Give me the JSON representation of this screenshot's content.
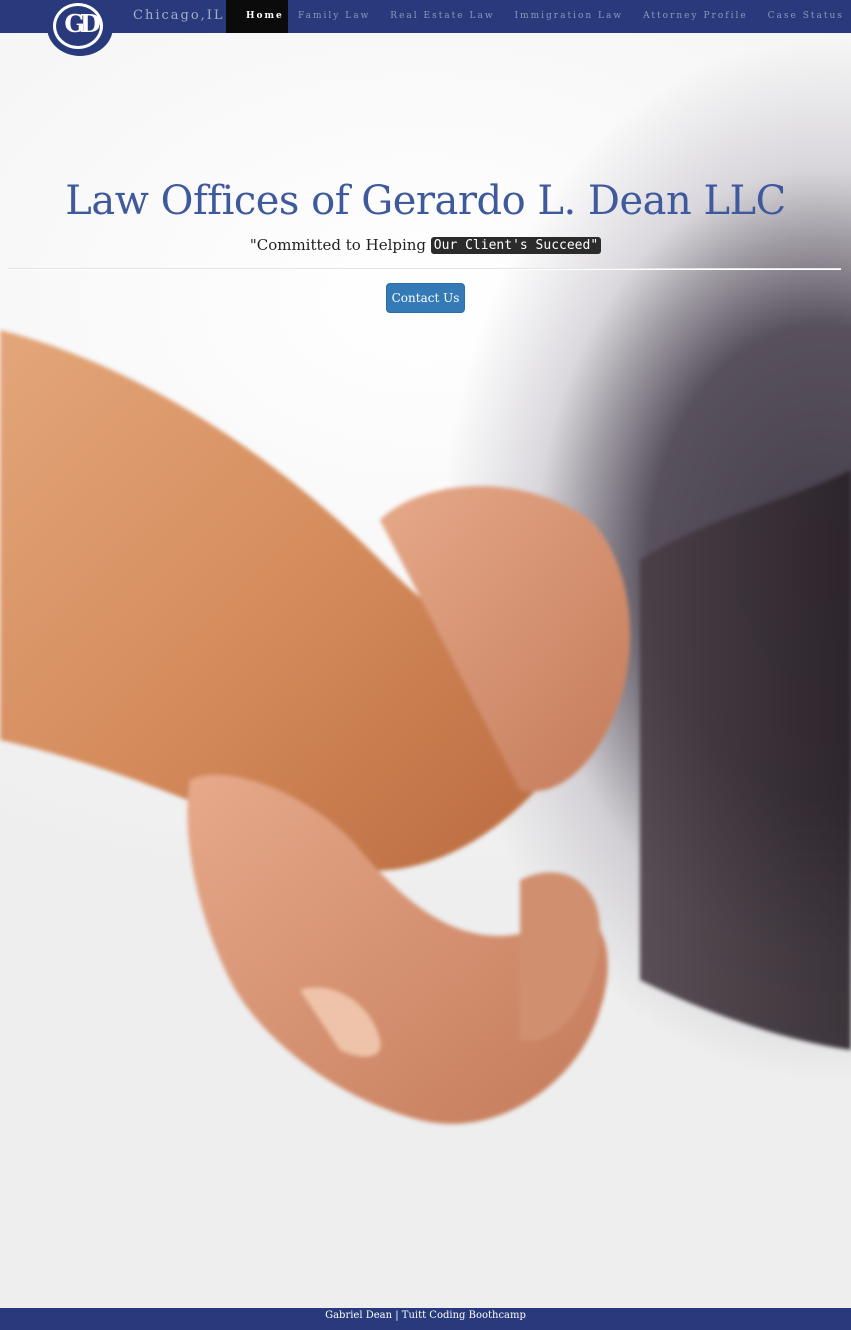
{
  "navbar": {
    "logo_text": "GD",
    "location": "Chicago,IL",
    "items": [
      {
        "label": "Home",
        "active": true
      },
      {
        "label": "Family Law",
        "active": false
      },
      {
        "label": "Real Estate Law",
        "active": false
      },
      {
        "label": "Immigration Law",
        "active": false
      },
      {
        "label": "Attorney Profile",
        "active": false
      },
      {
        "label": "Case Status",
        "active": false
      }
    ]
  },
  "hero": {
    "title": "Law Offices of Gerardo L. Dean LLC",
    "tagline_prefix": "\"Committed to Helping ",
    "tagline_highlight": "Our Client's Succeed\"",
    "contact_button_label": "Contact Us",
    "background_image": "handshake-photo"
  },
  "footer": {
    "text": "Gabriel Dean | Tuitt Coding Boothcamp"
  },
  "colors": {
    "navbar_bg": "#283a7c",
    "title_color": "#3f5a9c",
    "button_bg": "#337ab7",
    "active_nav_bg": "#0b0b0b"
  }
}
